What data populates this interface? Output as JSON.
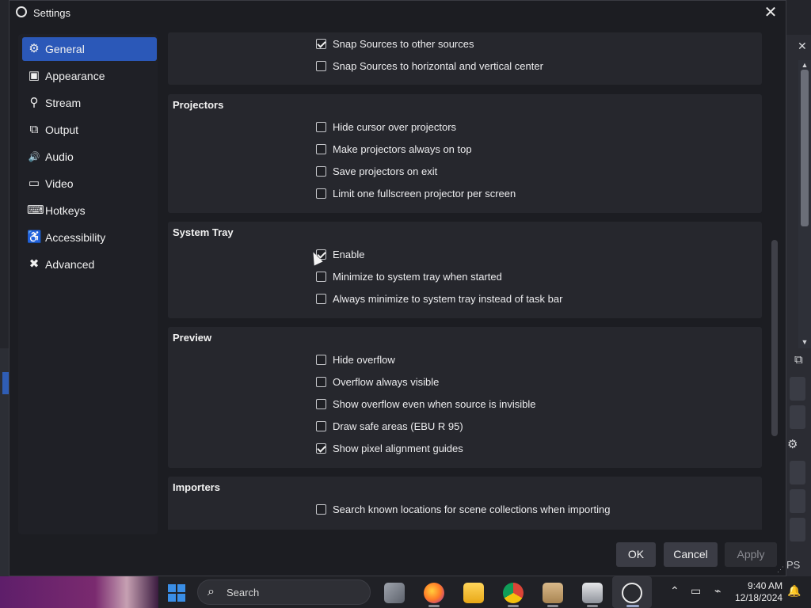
{
  "window": {
    "title": "Settings",
    "close_glyph": "✕"
  },
  "sidebar": {
    "items": [
      {
        "label": "General",
        "icon": "gear-icon",
        "glyph": "⚙",
        "active": true
      },
      {
        "label": "Appearance",
        "icon": "appearance-icon",
        "glyph": "▣"
      },
      {
        "label": "Stream",
        "icon": "stream-icon",
        "glyph": "⚲"
      },
      {
        "label": "Output",
        "icon": "output-icon",
        "glyph": "⧉"
      },
      {
        "label": "Audio",
        "icon": "audio-icon",
        "glyph": "🔊"
      },
      {
        "label": "Video",
        "icon": "video-icon",
        "glyph": "▭"
      },
      {
        "label": "Hotkeys",
        "icon": "keyboard-icon",
        "glyph": "⌨"
      },
      {
        "label": "Accessibility",
        "icon": "accessibility-icon",
        "glyph": "♿"
      },
      {
        "label": "Advanced",
        "icon": "wrench-icon",
        "glyph": "✖"
      }
    ]
  },
  "sections": {
    "snapping": {
      "options": [
        {
          "label": "Snap Sources to other sources",
          "checked": true
        },
        {
          "label": "Snap Sources to horizontal and vertical center",
          "checked": false
        }
      ]
    },
    "projectors": {
      "title": "Projectors",
      "options": [
        {
          "label": "Hide cursor over projectors",
          "checked": false
        },
        {
          "label": "Make projectors always on top",
          "checked": false
        },
        {
          "label": "Save projectors on exit",
          "checked": false
        },
        {
          "label": "Limit one fullscreen projector per screen",
          "checked": false
        }
      ]
    },
    "system_tray": {
      "title": "System Tray",
      "options": [
        {
          "label": "Enable",
          "checked": true
        },
        {
          "label": "Minimize to system tray when started",
          "checked": false
        },
        {
          "label": "Always minimize to system tray instead of task bar",
          "checked": false
        }
      ]
    },
    "preview": {
      "title": "Preview",
      "options": [
        {
          "label": "Hide overflow",
          "checked": false
        },
        {
          "label": "Overflow always visible",
          "checked": false
        },
        {
          "label": "Show overflow even when source is invisible",
          "checked": false
        },
        {
          "label": "Draw safe areas (EBU R 95)",
          "checked": false
        },
        {
          "label": "Show pixel alignment guides",
          "checked": true
        }
      ]
    },
    "importers": {
      "title": "Importers",
      "options": [
        {
          "label": "Search known locations for scene collections when importing",
          "checked": false
        }
      ]
    }
  },
  "buttons": {
    "ok": "OK",
    "cancel": "Cancel",
    "apply": "Apply"
  },
  "background": {
    "fps_fragment": "PS"
  },
  "taskbar": {
    "search_placeholder": "Search",
    "time": "9:40 AM",
    "date": "12/18/2024",
    "apps": [
      "task-view-icon",
      "firefox-icon",
      "file-explorer-icon",
      "chrome-icon",
      "archive-icon",
      "package-icon",
      "obs-icon"
    ]
  },
  "colors": {
    "accent": "#2b58b8",
    "dialog_bg": "#1c1d22",
    "group_bg": "#26272d"
  }
}
